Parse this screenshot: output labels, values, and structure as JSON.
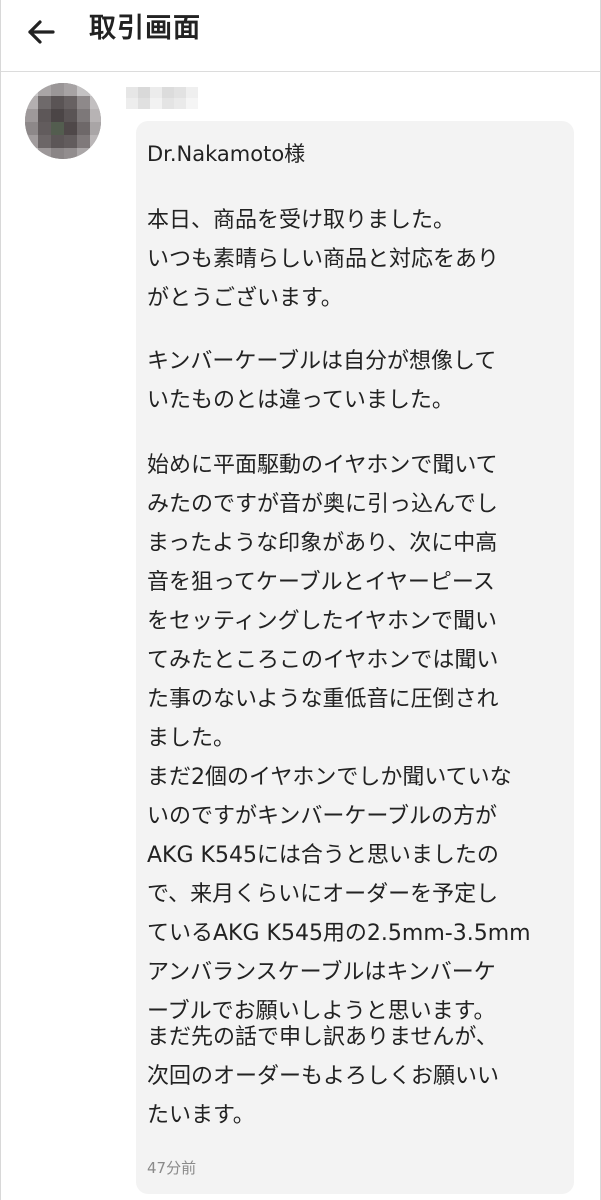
{
  "header": {
    "title": "取引画面",
    "back_icon": "arrow-left-icon"
  },
  "message": {
    "avatar_icon": "avatar-pixelated",
    "username_label": "pixelated-username",
    "greeting": "Dr.Nakamoto様",
    "paragraphs": [
      {
        "lines": [
          "本日、商品を受け取りました。",
          "いつも素晴らしい商品と対応をあり",
          "がとうございます。"
        ]
      },
      {
        "lines": [
          "キンバーケーブルは自分が想像して",
          "いたものとは違っていました。"
        ]
      },
      {
        "lines": [
          "始めに平面駆動のイヤホンで聞いて",
          "みたのですが音が奥に引っ込んでし",
          "まったような印象があり、次に中高",
          "音を狙ってケーブルとイヤーピース",
          "をセッティングしたイヤホンで聞い",
          "てみたところこのイヤホンでは聞い",
          "た事のないような重低音に圧倒され",
          "ました。"
        ]
      },
      {
        "lines": [
          "まだ2個のイヤホンでしか聞いていな",
          "いのですがキンバーケーブルの方が",
          "AKG K545には合うと思いましたの",
          "で、来月くらいにオーダーを予定し",
          "ているAKG K545用の2.5mm-3.5mm",
          "アンバランスケーブルはキンバーケ",
          "ーブルでお願いしようと思います。"
        ]
      },
      {
        "lines": [
          "まだ先の話で申し訳ありませんが、",
          "次回のオーダーもよろしくお願いい",
          "たいます。"
        ]
      }
    ],
    "timestamp": "47分前"
  },
  "colors": {
    "bubble_bg": "#f3f3f3",
    "text": "#222222",
    "timestamp": "#8a8a8a",
    "divider": "#dcdcdc"
  }
}
